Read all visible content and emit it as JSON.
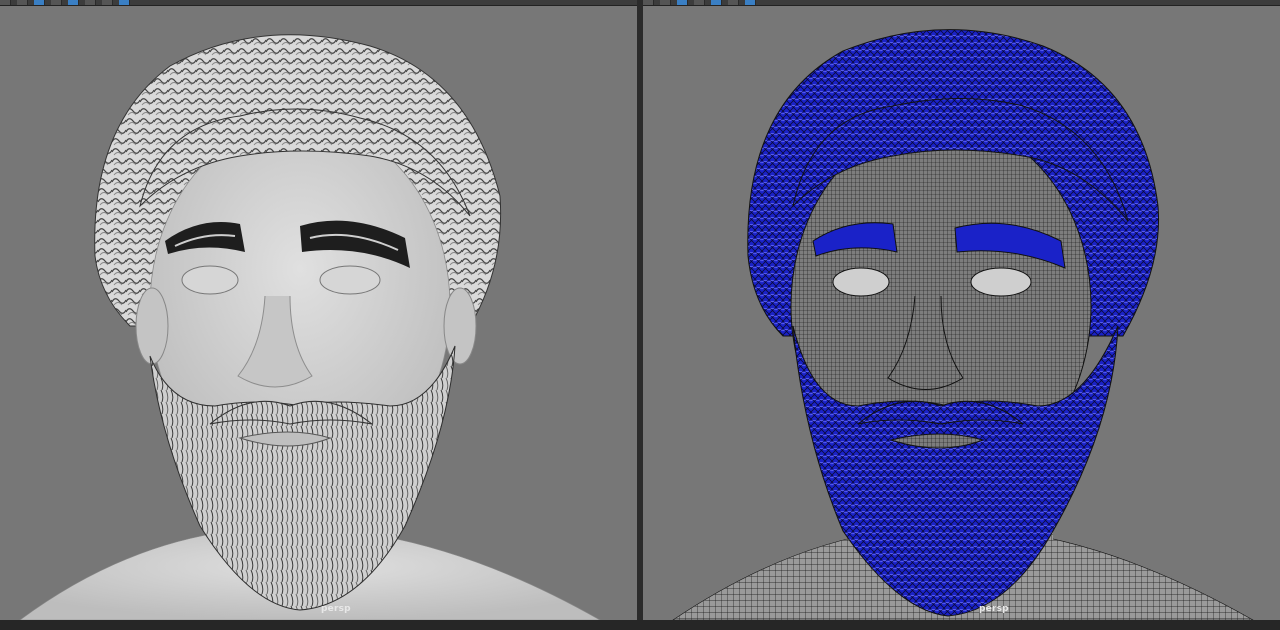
{
  "viewports": [
    {
      "camera": "persp",
      "mode": "smooth-shaded"
    },
    {
      "camera": "persp",
      "mode": "wireframe"
    }
  ],
  "colors": {
    "viewport_bg": "#777777",
    "shaded_skin": "#cfcfcf",
    "wire_line": "#111111",
    "wire_selected": "#1a22c8",
    "label_text": "#e8e8e8"
  },
  "icons": [
    "toolbar-icon",
    "viewport-camera-icon"
  ]
}
